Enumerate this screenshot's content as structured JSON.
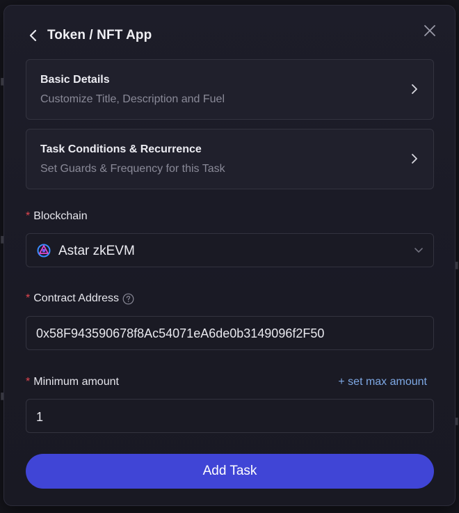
{
  "header": {
    "title": "Token / NFT App"
  },
  "cards": [
    {
      "title": "Basic Details",
      "subtitle": "Customize Title, Description and Fuel"
    },
    {
      "title": "Task Conditions & Recurrence",
      "subtitle": "Set Guards & Frequency for this Task"
    }
  ],
  "blockchain": {
    "required_mark": "*",
    "label": "Blockchain",
    "value": "Astar zkEVM",
    "icon": "astar-zkevm-logo"
  },
  "contract": {
    "required_mark": "*",
    "label": "Contract Address",
    "value": "0x58F943590678f8Ac54071eA6de0b3149096f2F50",
    "icon": "question-circle-icon"
  },
  "minimum": {
    "required_mark": "*",
    "label": "Minimum amount",
    "link": "+ set max amount",
    "value": "1"
  },
  "actions": {
    "submit_label": "Add Task"
  },
  "colors": {
    "accent": "#4045d6",
    "required": "#e0454f",
    "link": "#7ea8e4"
  }
}
